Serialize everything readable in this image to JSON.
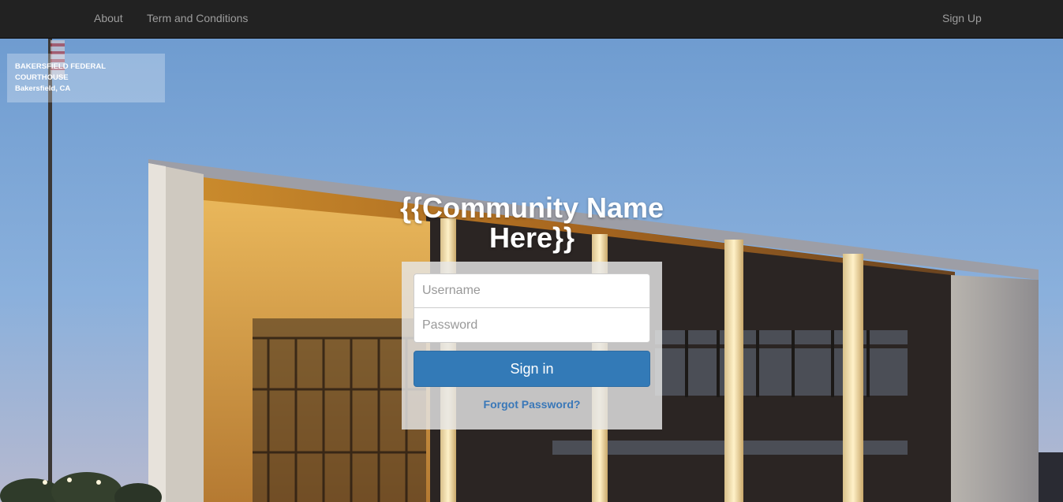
{
  "nav": {
    "about_label": "About",
    "terms_label": "Term and Conditions",
    "signup_label": "Sign Up"
  },
  "caption": {
    "line1": "BAKERSFIELD FEDERAL",
    "line2": "COURTHOUSE",
    "line3": "Bakersfield, CA"
  },
  "heading": {
    "title": "{{Community Name Here}}"
  },
  "login": {
    "username_placeholder": "Username",
    "password_placeholder": "Password",
    "signin_label": "Sign in",
    "forgot_label": "Forgot Password?"
  },
  "colors": {
    "navbar": "#222222",
    "nav_text": "#9d9d9d",
    "primary_button": "#337ab7",
    "link": "#3a78b8"
  }
}
